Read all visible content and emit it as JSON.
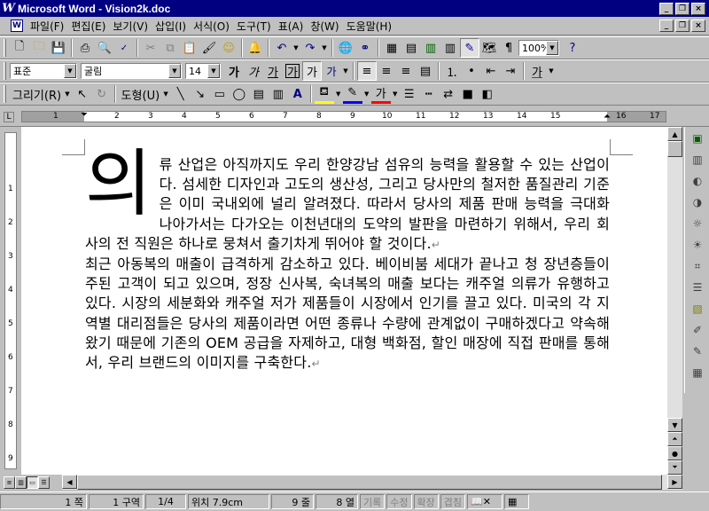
{
  "window": {
    "app_title": "Microsoft Word - Vision2k.doc",
    "minimize_label": "_",
    "restore_label": "❐",
    "close_label": "×"
  },
  "menubar": {
    "items": [
      "파일(F)",
      "편집(E)",
      "보기(V)",
      "삽입(I)",
      "서식(O)",
      "도구(T)",
      "표(A)",
      "창(W)",
      "도움말(H)"
    ]
  },
  "standard_toolbar": {
    "zoom": "100%"
  },
  "format_toolbar": {
    "style": "표준",
    "font": "굴림",
    "size": "14",
    "bold": "가",
    "italic": "가",
    "underline": "가",
    "border_char": "가",
    "shade_char": "가",
    "phonetic": "가",
    "highlight_char": "가"
  },
  "drawing_toolbar": {
    "draw_label": "그리기(R)",
    "shapes_label": "도형(U)",
    "font_color_char": "가"
  },
  "ruler": {
    "numbers": [
      "1",
      "2",
      "3",
      "4",
      "5",
      "6",
      "7",
      "8",
      "9",
      "10",
      "11",
      "12",
      "13",
      "14",
      "15",
      "16",
      "17"
    ],
    "vertical_numbers": [
      "1",
      "2",
      "3",
      "4",
      "5",
      "6",
      "7",
      "8",
      "9"
    ]
  },
  "document": {
    "dropcap": "의",
    "para1": "류 산업은 아직까지도 우리 한양강남 섬유의 능력을 활용할 수 있는 산업이다. 섬세한 디자인과 고도의 생산성, 그리고 당사만의 철저한 품질관리 기준은 이미 국내외에 널리 알려졌다. 따라서 당사의 제품 판매 능력을 극대화  나아가서는 다가오는 이천년대의 도약의 발판을 마련하기 위해서, 우리 회사의 전 직원은 하나로 뭉쳐서 출기차게 뛰어야 할 것이다.",
    "para2": "최근 아동복의 매출이 급격하게 감소하고 있다. 베이비붐 세대가 끝나고 청 장년층들이 주된 고객이 되고 있으며,  정장 신사복, 숙녀복의 매출 보다는 캐주얼 의류가 유행하고 있다. 시장의 세분화와 캐주얼 저가 제품들이 시장에서 인기를 끌고 있다. 미국의 각 지역별 대리점들은 당사의 제품이라면 어떤 종류나 수량에 관계없이 구매하겠다고 약속해 왔기 때문에 기존의 OEM 공급을 자제하고, 대형 백화점, 할인 매장에 직접 판매를 통해서, 우리 브랜드의 이미지를 구축한다.",
    "para_mark": "↵"
  },
  "statusbar": {
    "page": "1 쪽",
    "section": "1 구역",
    "page_of": "1/4",
    "position": "위치 7.9cm",
    "line": "9 줄",
    "column": "8 열",
    "rec": "기록",
    "trk": "수정",
    "ext": "확장",
    "ovr": "겹침"
  },
  "colors": {
    "titlebar": "#000080",
    "chrome": "#c0c0c0",
    "page": "#ffffff"
  }
}
